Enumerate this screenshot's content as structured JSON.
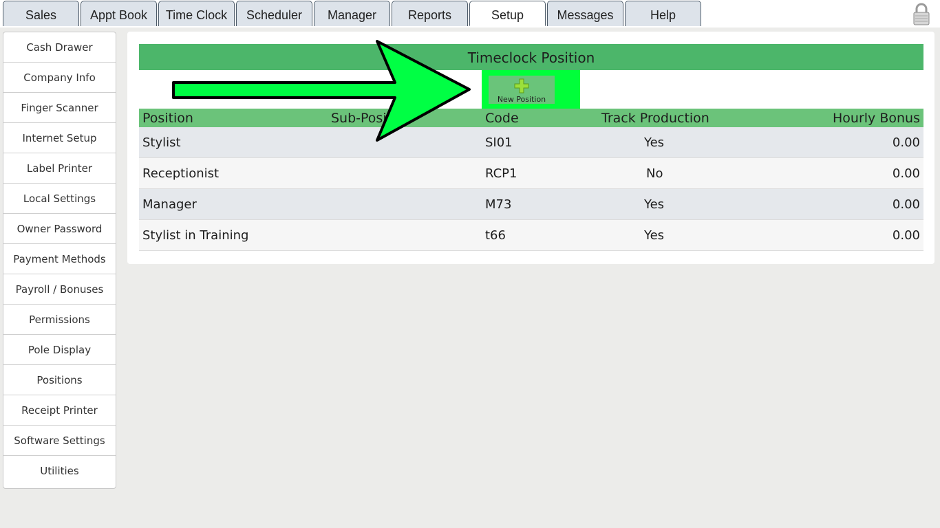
{
  "tabs": [
    {
      "label": "Sales"
    },
    {
      "label": "Appt Book"
    },
    {
      "label": "Time Clock"
    },
    {
      "label": "Scheduler"
    },
    {
      "label": "Manager"
    },
    {
      "label": "Reports"
    },
    {
      "label": "Setup"
    },
    {
      "label": "Messages"
    },
    {
      "label": "Help"
    }
  ],
  "active_tab": "Setup",
  "sidebar": {
    "items": [
      {
        "label": "Cash Drawer"
      },
      {
        "label": "Company Info"
      },
      {
        "label": "Finger Scanner"
      },
      {
        "label": "Internet Setup"
      },
      {
        "label": "Label Printer"
      },
      {
        "label": "Local Settings"
      },
      {
        "label": "Owner Password"
      },
      {
        "label": "Payment Methods"
      },
      {
        "label": "Payroll / Bonuses"
      },
      {
        "label": "Permissions"
      },
      {
        "label": "Pole Display"
      },
      {
        "label": "Positions"
      },
      {
        "label": "Receipt Printer"
      },
      {
        "label": "Software Settings"
      },
      {
        "label": "Utilities"
      }
    ]
  },
  "main": {
    "title": "Timeclock Position",
    "new_button_label": "New Position",
    "columns": {
      "position": "Position",
      "sub_position": "Sub-Position",
      "code": "Code",
      "track_production": "Track Production",
      "hourly_bonus": "Hourly Bonus"
    },
    "rows": [
      {
        "position": "Stylist",
        "sub_position": "",
        "code": "SI01",
        "track_production": "Yes",
        "hourly_bonus": "0.00"
      },
      {
        "position": "Receptionist",
        "sub_position": "",
        "code": "RCP1",
        "track_production": "No",
        "hourly_bonus": "0.00"
      },
      {
        "position": "Manager",
        "sub_position": "",
        "code": "M73",
        "track_production": "Yes",
        "hourly_bonus": "0.00"
      },
      {
        "position": "Stylist in Training",
        "sub_position": "",
        "code": "t66",
        "track_production": "Yes",
        "hourly_bonus": "0.00"
      }
    ]
  },
  "colors": {
    "header_green": "#4cb66a",
    "highlight_green": "#00ff3a",
    "arrow_green": "#00ff44"
  }
}
